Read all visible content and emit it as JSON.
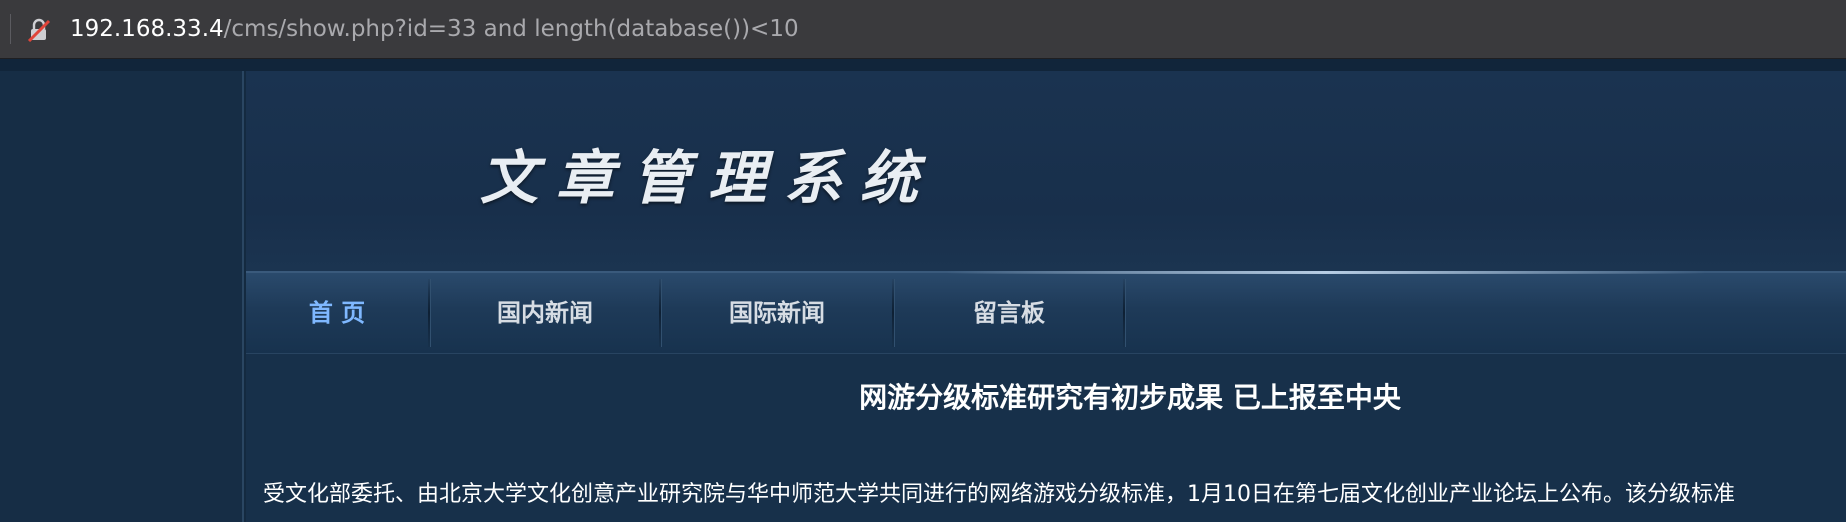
{
  "browser": {
    "url_host": "192.168.33.4",
    "url_path": "/cms/show.php?id=33 and length(database())<10",
    "security_icon": "insecure-lock-icon"
  },
  "site": {
    "logo_title": "文章管理系统",
    "nav": [
      {
        "label": "首 页",
        "active": true
      },
      {
        "label": "国内新闻",
        "active": false
      },
      {
        "label": "国际新闻",
        "active": false
      },
      {
        "label": "留言板",
        "active": false
      }
    ]
  },
  "article": {
    "title": "网游分级标准研究有初步成果 已上报至中央",
    "body": "受文化部委托、由北京大学文化创意产业研究院与华中师范大学共同进行的网络游戏分级标准，1月10日在第七届文化创业产业论坛上公布。该分级标准"
  },
  "colors": {
    "nav_active": "#7fb8ff",
    "page_bg": "#17304a",
    "address_bar": "#3a3a3d"
  }
}
